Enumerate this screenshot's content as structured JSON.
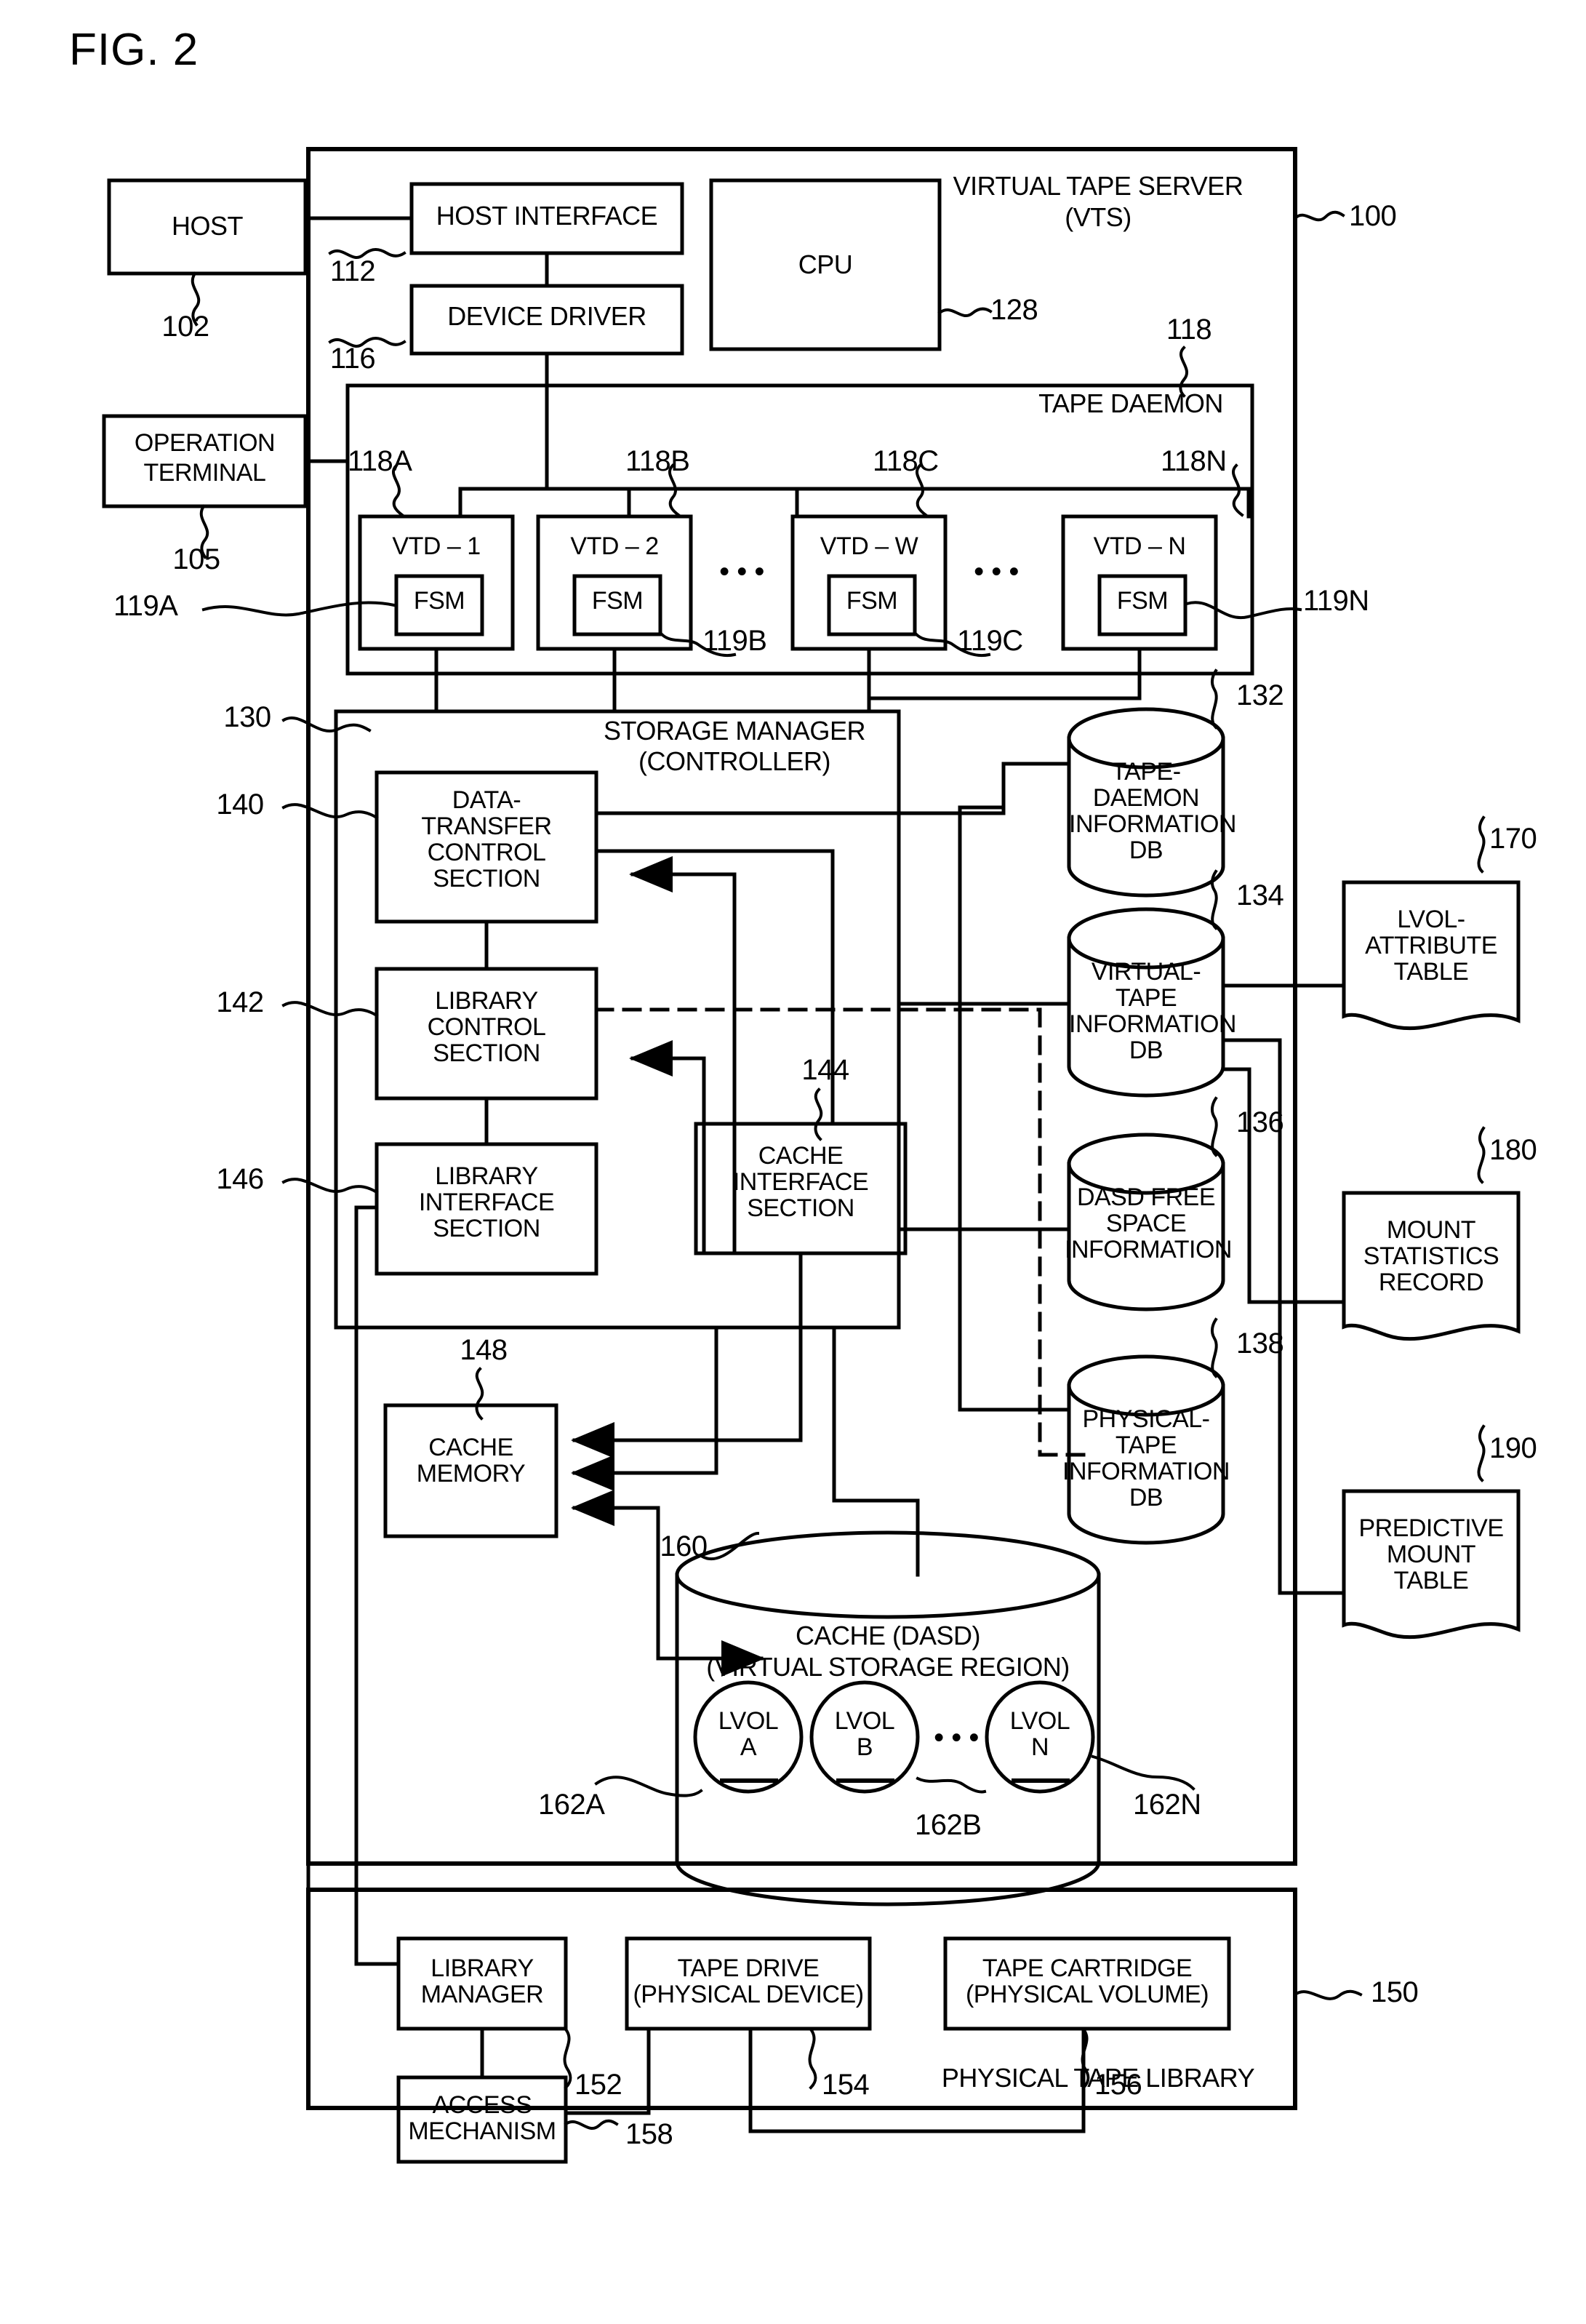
{
  "figure": {
    "title": "FIG. 2"
  },
  "blocks": {
    "host": "HOST",
    "operation_terminal_line1": "OPERATION",
    "operation_terminal_line2": "TERMINAL",
    "host_interface": "HOST INTERFACE",
    "device_driver": "DEVICE DRIVER",
    "cpu": "CPU",
    "vts_line1": "VIRTUAL TAPE SERVER",
    "vts_line2": "(VTS)",
    "tape_daemon": "TAPE DAEMON",
    "vtd_1": "VTD – 1",
    "vtd_2": "VTD – 2",
    "vtd_w": "VTD – W",
    "vtd_n": "VTD – N",
    "fsm": "FSM",
    "ellipsis": "• • •",
    "storage_manager_line1": "STORAGE MANAGER",
    "storage_manager_line2": "(CONTROLLER)",
    "data_transfer_control_section": "DATA-\nTRANSFER\nCONTROL\nSECTION",
    "library_control_section": "LIBRARY\nCONTROL\nSECTION",
    "library_interface_section": "LIBRARY\nINTERFACE\nSECTION",
    "cache_interface_section": "CACHE\nINTERFACE\nSECTION",
    "cache_memory": "CACHE\nMEMORY",
    "tape_daemon_db": "TAPE-DAEMON\nINFORMATION\nDB",
    "virtual_tape_db": "VIRTUAL-TAPE\nINFORMATION\nDB",
    "dasd_free_space": "DASD FREE\nSPACE\nINFORMATION",
    "physical_tape_db": "PHYSICAL-TAPE\nINFORMATION\nDB",
    "lvol_attribute_table": "LVOL-\nATTRIBUTE\nTABLE",
    "mount_statistics_record": "MOUNT\nSTATISTICS\nRECORD",
    "predictive_mount_table": "PREDICTIVE\nMOUNT\nTABLE",
    "cache_dasd_line1": "CACHE (DASD)",
    "cache_dasd_line2": "(VIRTUAL STORAGE REGION)",
    "lvol_a": "LVOL\nA",
    "lvol_b": "LVOL\nB",
    "lvol_n": "LVOL\nN",
    "library_manager": "LIBRARY\nMANAGER",
    "tape_drive": "TAPE DRIVE\n(PHYSICAL DEVICE)",
    "tape_cartridge": "TAPE CARTRIDGE\n(PHYSICAL VOLUME)",
    "access_mechanism": "ACCESS\nMECHANISM",
    "physical_tape_library": "PHYSICAL TAPE LIBRARY"
  },
  "refs": {
    "r100": "100",
    "r102": "102",
    "r105": "105",
    "r112": "112",
    "r116": "116",
    "r118": "118",
    "r118A": "118A",
    "r118B": "118B",
    "r118C": "118C",
    "r118N": "118N",
    "r119A": "119A",
    "r119B": "119B",
    "r119C": "119C",
    "r119N": "119N",
    "r128": "128",
    "r130": "130",
    "r132": "132",
    "r134": "134",
    "r136": "136",
    "r138": "138",
    "r140": "140",
    "r142": "142",
    "r144": "144",
    "r146": "146",
    "r148": "148",
    "r150": "150",
    "r152": "152",
    "r154": "154",
    "r156": "156",
    "r158": "158",
    "r160": "160",
    "r162A": "162A",
    "r162B": "162B",
    "r162N": "162N",
    "r170": "170",
    "r180": "180",
    "r190": "190"
  },
  "style": {
    "ink": "#000000",
    "paper": "#ffffff"
  }
}
